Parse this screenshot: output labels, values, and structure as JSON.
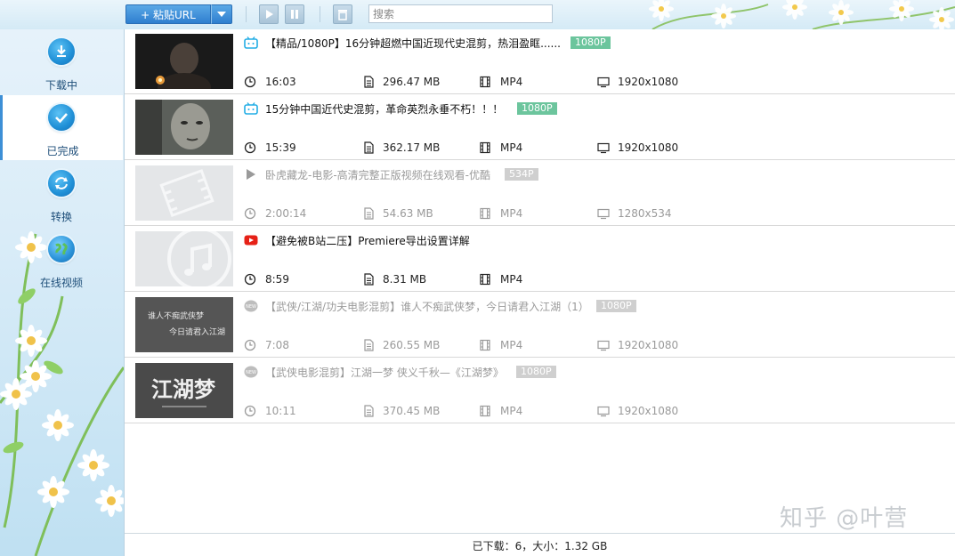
{
  "toolbar": {
    "paste_label": "+ 粘贴URL",
    "search_placeholder": "搜索"
  },
  "sidebar": {
    "items": [
      {
        "label": "下载中",
        "icon": "download-icon"
      },
      {
        "label": "已完成",
        "icon": "check-icon"
      },
      {
        "label": "转换",
        "icon": "convert-icon"
      },
      {
        "label": "在线视频",
        "icon": "globe-icon"
      }
    ],
    "active_index": 1
  },
  "videos": [
    {
      "site": "bilibili-icon",
      "title": "【精品/1080P】16分钟超燃中国近现代史混剪，热泪盈眶......",
      "quality": "1080P",
      "duration": "16:03",
      "size": "296.47 MB",
      "format": "MP4",
      "resolution": "1920x1080",
      "dim": false
    },
    {
      "site": "bilibili-icon",
      "title": "15分钟中国近代史混剪，革命英烈永垂不朽！！！",
      "quality": "1080P",
      "duration": "15:39",
      "size": "362.17 MB",
      "format": "MP4",
      "resolution": "1920x1080",
      "dim": false
    },
    {
      "site": "youku-icon",
      "title": "卧虎藏龙-电影-高清完整正版视频在线观看-优酷",
      "quality": "534P",
      "duration": "2:00:14",
      "size": "54.63 MB",
      "format": "MP4",
      "resolution": "1280x534",
      "dim": true
    },
    {
      "site": "youtube-icon",
      "title": "【避免被B站二压】Premiere导出设置详解",
      "quality": "",
      "duration": "8:59",
      "size": "8.31 MB",
      "format": "MP4",
      "resolution": "",
      "dim": false
    },
    {
      "site": "new-icon",
      "title": "【武侠/江湖/功夫电影混剪】谁人不痴武侠梦，今日请君入江湖（1）",
      "quality": "1080P",
      "duration": "7:08",
      "size": "260.55 MB",
      "format": "MP4",
      "resolution": "1920x1080",
      "dim": true
    },
    {
      "site": "new-icon",
      "title": "【武侠电影混剪】江湖一梦 侠义千秋—《江湖梦》",
      "quality": "1080P",
      "duration": "10:11",
      "size": "370.45 MB",
      "format": "MP4",
      "resolution": "1920x1080",
      "dim": true
    }
  ],
  "thumb_text": {
    "row5_line1": "谁人不痴武侠梦",
    "row5_line2": "今日请君入江湖",
    "row6_calligraphy": "江湖梦"
  },
  "status": {
    "text": "已下载：6，大小：1.32 GB"
  },
  "watermark": "知乎 @叶营",
  "colors": {
    "accent": "#2f7fcf",
    "badge": "#6cc59d",
    "badge_dim": "#cfcfcf"
  }
}
